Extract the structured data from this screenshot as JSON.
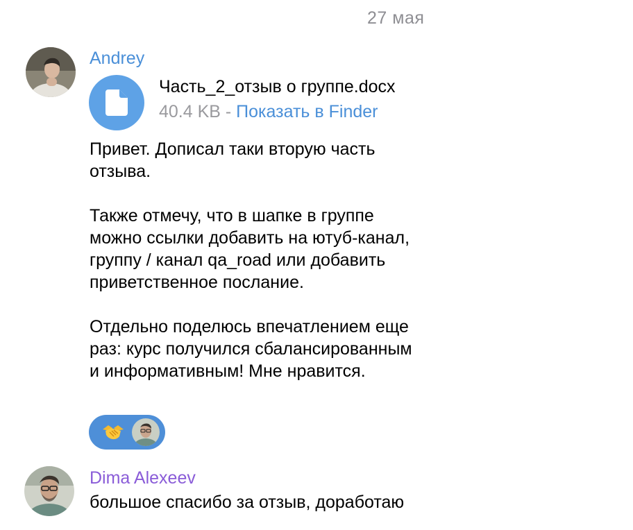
{
  "date_separator": "27 мая",
  "colors": {
    "andrey_name": "#4a8fd8",
    "dima_name": "#8a5cd8",
    "link": "#4a8fd8",
    "file_icon_bg": "#5ea2e6",
    "reaction_bg": "#4e8fd8",
    "meta_gray": "#9a9a9e"
  },
  "messages": [
    {
      "sender": "Andrey",
      "avatar_icon": "user-photo-avatar",
      "attachment": {
        "icon": "document-file-icon",
        "file_name": "Часть_2_отзыв о группе.docx",
        "file_size": "40.4 KB",
        "separator": " - ",
        "action_label": "Показать в Finder"
      },
      "paragraphs": [
        "Привет. Дописал таки вторую часть отзыва.",
        "Также отмечу, что в шапке в группе можно ссылки добавить на ютуб-канал, группу / канал qa_road или добавить приветственное послание.",
        "Отдельно поделюсь впечатлением еще раз: курс получился сбалансированным и информативным! Мне нравится."
      ],
      "reaction": {
        "emoji_icon": "handshake-icon",
        "reactor_avatar": "user-photo-avatar"
      }
    },
    {
      "sender": "Dima Alexeev",
      "avatar_icon": "user-photo-avatar",
      "text": "большое спасибо за отзыв, доработаю"
    }
  ]
}
